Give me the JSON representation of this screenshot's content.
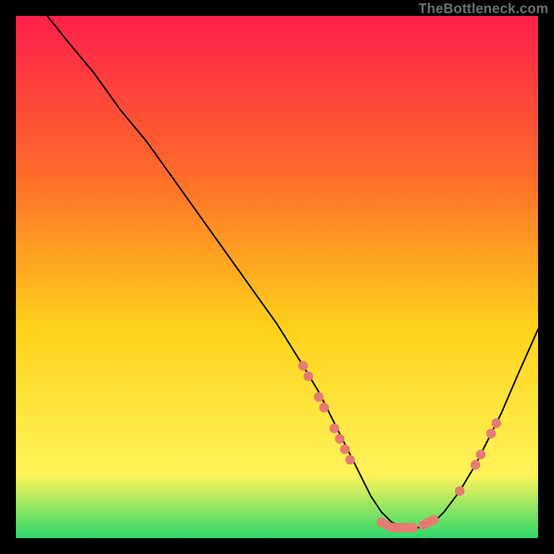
{
  "watermark": "TheBottleneck.com",
  "colors": {
    "gradient_top": "#ff1f4b",
    "gradient_mid1": "#ff6a2a",
    "gradient_mid2": "#ffd21a",
    "gradient_mid3": "#fff45a",
    "gradient_bottom": "#2bd86a",
    "curve": "#000000",
    "points": "#e77b73",
    "frame": "#000000"
  },
  "chart_data": {
    "type": "line",
    "title": "",
    "xlabel": "",
    "ylabel": "",
    "xlim": [
      0,
      100
    ],
    "ylim": [
      0,
      100
    ],
    "grid": false,
    "legend": false,
    "series": [
      {
        "name": "bottleneck-curve",
        "x": [
          6,
          10,
          15,
          20,
          25,
          30,
          35,
          40,
          45,
          50,
          55,
          58,
          60,
          62,
          64,
          66,
          68,
          70,
          72,
          74,
          76,
          78,
          80,
          82,
          85,
          88,
          90,
          93,
          96,
          100
        ],
        "y": [
          100,
          95,
          89,
          82,
          76,
          69,
          62,
          55,
          48,
          41,
          33,
          28,
          24,
          20,
          16,
          12,
          8,
          5,
          3,
          2,
          2,
          2,
          3,
          5,
          9,
          14,
          18,
          24,
          31,
          40
        ]
      }
    ],
    "points": [
      {
        "x": 55,
        "y": 33
      },
      {
        "x": 56,
        "y": 31
      },
      {
        "x": 58,
        "y": 27
      },
      {
        "x": 59,
        "y": 25
      },
      {
        "x": 61,
        "y": 21
      },
      {
        "x": 62,
        "y": 19
      },
      {
        "x": 63,
        "y": 17
      },
      {
        "x": 64,
        "y": 15
      },
      {
        "x": 70,
        "y": 3
      },
      {
        "x": 71,
        "y": 2.5
      },
      {
        "x": 72,
        "y": 2
      },
      {
        "x": 73,
        "y": 2
      },
      {
        "x": 74,
        "y": 2
      },
      {
        "x": 75,
        "y": 2
      },
      {
        "x": 76,
        "y": 2
      },
      {
        "x": 78,
        "y": 2.5
      },
      {
        "x": 79,
        "y": 3
      },
      {
        "x": 80,
        "y": 3.5
      },
      {
        "x": 85,
        "y": 9
      },
      {
        "x": 88,
        "y": 14
      },
      {
        "x": 89,
        "y": 16
      },
      {
        "x": 91,
        "y": 20
      },
      {
        "x": 92,
        "y": 22
      }
    ]
  }
}
